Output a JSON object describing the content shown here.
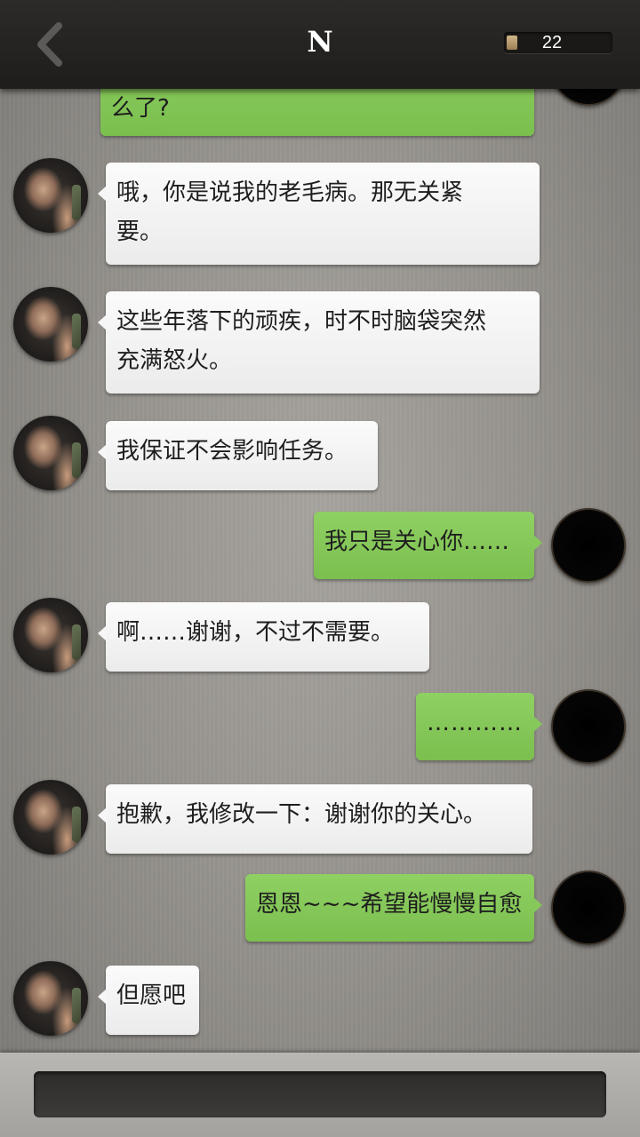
{
  "header": {
    "title": "N",
    "back_icon": "chevron-left-icon",
    "counter": "22"
  },
  "messages": [
    {
      "side": "me",
      "text": "么了?"
    },
    {
      "side": "them",
      "text": "哦，你是说我的老毛病。那无关紧\n要。"
    },
    {
      "side": "them",
      "text": "这些年落下的顽疾，时不时脑袋突然\n充满怒火。"
    },
    {
      "side": "them",
      "text": "我保证不会影响任务。"
    },
    {
      "side": "me",
      "text": "我只是关心你……"
    },
    {
      "side": "them",
      "text": "啊……谢谢，不过不需要。"
    },
    {
      "side": "me",
      "text": "…………"
    },
    {
      "side": "them",
      "text": "抱歉，我修改一下：谢谢你的关心。"
    },
    {
      "side": "me",
      "text": "恩恩~~~希望能慢慢自愈"
    },
    {
      "side": "them",
      "text": "但愿吧"
    }
  ],
  "footer": {
    "input_value": ""
  },
  "colors": {
    "my_bubble": "#86c85a",
    "their_bubble": "#f4f4f4",
    "header": "#252422"
  }
}
